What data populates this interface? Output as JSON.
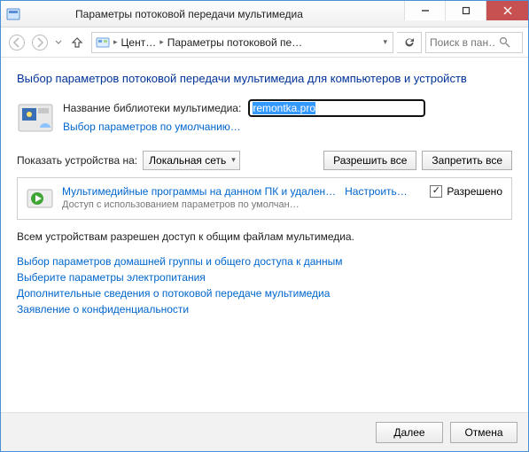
{
  "window": {
    "title": "Параметры потоковой передачи мультимедиа"
  },
  "nav": {
    "crumb1": "Цент…",
    "crumb2": "Параметры потоковой пе…",
    "search_placeholder": "Поиск в пан…"
  },
  "heading": "Выбор параметров потоковой передачи мультимедиа для компьютеров и устройств",
  "library": {
    "label": "Название библиотеки мультимедиа:",
    "value": "remontka.pro",
    "defaults_link": "Выбор параметров по умолчанию…"
  },
  "show_row": {
    "label": "Показать устройства на:",
    "value": "Локальная сеть",
    "allow_all": "Разрешить все",
    "block_all": "Запретить все"
  },
  "device": {
    "title": "Мультимедийные программы на данном ПК и удален…",
    "configure": "Настроить…",
    "sub": "Доступ с использованием параметров по умолчан…",
    "status": "Разрешено",
    "checked": true
  },
  "footnote": "Всем устройствам разрешен доступ к общим файлам мультимедиа.",
  "links": {
    "l1": "Выбор параметров домашней группы и общего доступа к данным",
    "l2": "Выберите параметры электропитания",
    "l3": "Дополнительные сведения о потоковой передаче мультимедиа",
    "l4": "Заявление о конфиденциальности"
  },
  "footer": {
    "ok": "Далее",
    "cancel": "Отмена"
  }
}
